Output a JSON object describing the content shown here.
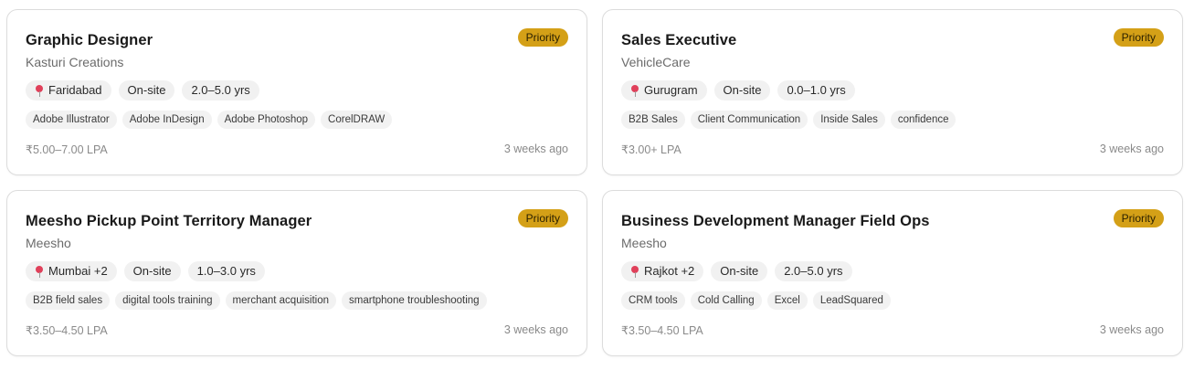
{
  "cards": [
    {
      "title": "Graphic Designer",
      "company": "Kasturi Creations",
      "badge": "Priority",
      "location": "Faridabad",
      "work_mode": "On-site",
      "experience": "2.0–5.0 yrs",
      "skills": [
        "Adobe Illustrator",
        "Adobe InDesign",
        "Adobe Photoshop",
        "CorelDRAW"
      ],
      "salary": "₹5.00–7.00 LPA",
      "posted": "3 weeks ago"
    },
    {
      "title": "Sales Executive",
      "company": "VehicleCare",
      "badge": "Priority",
      "location": "Gurugram",
      "work_mode": "On-site",
      "experience": "0.0–1.0 yrs",
      "skills": [
        "B2B Sales",
        "Client Communication",
        "Inside Sales",
        "confidence"
      ],
      "salary": "₹3.00+ LPA",
      "posted": "3 weeks ago"
    },
    {
      "title": "Meesho Pickup Point Territory Manager",
      "company": "Meesho",
      "badge": "Priority",
      "location": "Mumbai +2",
      "work_mode": "On-site",
      "experience": "1.0–3.0 yrs",
      "skills": [
        "B2B field sales",
        "digital tools training",
        "merchant acquisition",
        "smartphone troubleshooting"
      ],
      "salary": "₹3.50–4.50 LPA",
      "posted": "3 weeks ago"
    },
    {
      "title": "Business Development Manager Field Ops",
      "company": "Meesho",
      "badge": "Priority",
      "location": "Rajkot +2",
      "work_mode": "On-site",
      "experience": "2.0–5.0 yrs",
      "skills": [
        "CRM tools",
        "Cold Calling",
        "Excel",
        "LeadSquared"
      ],
      "salary": "₹3.50–4.50 LPA",
      "posted": "3 weeks ago"
    }
  ],
  "colors": {
    "badge_bg": "#d4a017",
    "pin": "#e0405a",
    "border": "#dcdcdc"
  },
  "icons": {
    "location": "round-pushpin-icon"
  }
}
